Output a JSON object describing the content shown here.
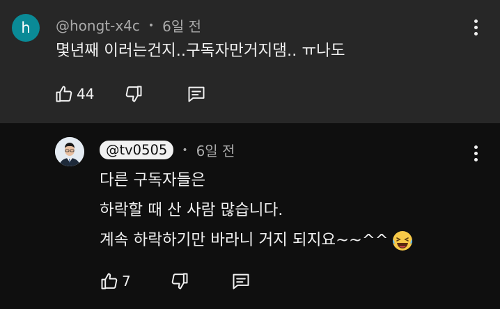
{
  "top_comment": {
    "avatar_letter": "h",
    "author": "@hongt-x4c",
    "separator": "•",
    "time": "6일 전",
    "text": "몇년째 이러는건지..구독자만거지댐.. ㅠ나도",
    "likes": "44"
  },
  "reply": {
    "author": "@tv0505",
    "separator": "•",
    "time": "6일 전",
    "lines": [
      "다른 구독자들은",
      "하락할 때 산 사람 많습니다.",
      "계속 하락하기만 바라니 거지 되지요~~^^"
    ],
    "likes": "7",
    "emoji": "laughing-with-tears"
  },
  "colors": {
    "top_bg": "#272727",
    "reply_bg": "#0f0f0f",
    "avatar_h": "#0a8a96",
    "meta_text": "#aaaaaa",
    "text": "#f1f1f1"
  }
}
